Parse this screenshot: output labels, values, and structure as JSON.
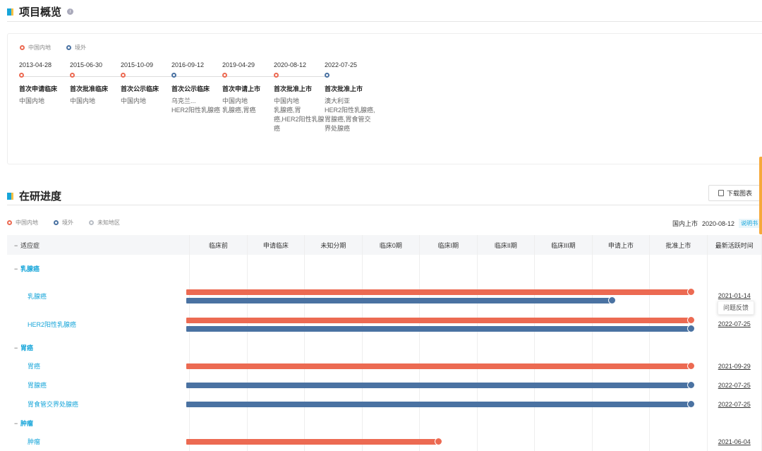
{
  "overview": {
    "title": "项目概览",
    "legend": [
      {
        "label": "中国内地",
        "color": "#ec6a52"
      },
      {
        "label": "境外",
        "color": "#4a72a2"
      }
    ],
    "timeline": [
      {
        "date": "2013-04-28",
        "title": "首次申请临床",
        "desc": "中国内地",
        "color": "red"
      },
      {
        "date": "2015-06-30",
        "title": "首次批准临床",
        "desc": "中国内地",
        "color": "red"
      },
      {
        "date": "2015-10-09",
        "title": "首次公示临床",
        "desc": "中国内地",
        "color": "red"
      },
      {
        "date": "2016-09-12",
        "title": "首次公示临床",
        "desc": "乌克兰...\nHER2阳性乳腺癌",
        "color": "blue"
      },
      {
        "date": "2019-04-29",
        "title": "首次申请上市",
        "desc": "中国内地\n乳腺癌,胃癌",
        "color": "red"
      },
      {
        "date": "2020-08-12",
        "title": "首次批准上市",
        "desc": "中国内地\n乳腺癌,胃癌,HER2阳性乳腺癌",
        "color": "red"
      },
      {
        "date": "2022-07-25",
        "title": "首次批准上市",
        "desc": "澳大利亚\nHER2阳性乳腺癌,胃腺癌,胃食管交界处腺癌",
        "color": "blue"
      }
    ]
  },
  "progress": {
    "title": "在研进度",
    "download_label": "下载图表",
    "legend": [
      {
        "label": "中国内地",
        "color": "#ec6a52"
      },
      {
        "label": "境外",
        "color": "#4a72a2"
      },
      {
        "label": "未知地区",
        "color": "#b9bec5"
      }
    ],
    "launch_label": "国内上市",
    "launch_date": "2020-08-12",
    "manual_link": "说明书",
    "columns": [
      "适应症",
      "临床前",
      "申请临床",
      "未知分期",
      "临床0期",
      "临床I期",
      "临床II期",
      "临床III期",
      "申请上市",
      "批准上市",
      "最新活跃时间"
    ],
    "groups": [
      {
        "name": "乳腺癌",
        "rows": [
          {
            "name": "乳腺癌",
            "date": "2021-01-14",
            "bars": [
              {
                "color": "red",
                "fraction": 1.0
              },
              {
                "color": "blue",
                "fraction": 0.843
              }
            ]
          },
          {
            "name": "HER2阳性乳腺癌",
            "date": "2022-07-25",
            "bars": [
              {
                "color": "red",
                "fraction": 1.0
              },
              {
                "color": "blue",
                "fraction": 1.0
              }
            ]
          }
        ]
      },
      {
        "name": "胃癌",
        "rows": [
          {
            "name": "胃癌",
            "date": "2021-09-29",
            "bars": [
              {
                "color": "red",
                "fraction": 1.0
              }
            ]
          },
          {
            "name": "胃腺癌",
            "date": "2022-07-25",
            "bars": [
              {
                "color": "blue",
                "fraction": 1.0
              }
            ]
          },
          {
            "name": "胃食管交界处腺癌",
            "date": "2022-07-25",
            "bars": [
              {
                "color": "blue",
                "fraction": 1.0
              }
            ]
          }
        ]
      },
      {
        "name": "肿瘤",
        "rows": [
          {
            "name": "肿瘤",
            "date": "2021-06-04",
            "bars": [
              {
                "color": "red",
                "fraction": 0.5
              }
            ]
          }
        ]
      }
    ],
    "feedback_label": "问题反馈"
  }
}
